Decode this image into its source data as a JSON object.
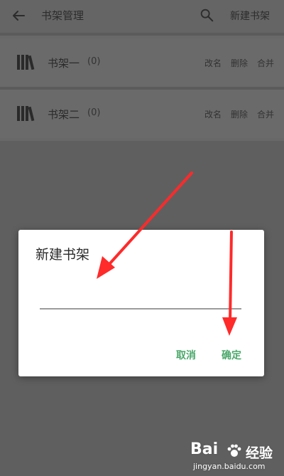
{
  "appbar": {
    "title": "书架管理",
    "new_shelf_label": "新建书架",
    "icons": [
      "back-arrow-icon",
      "search-icon"
    ]
  },
  "shelves": [
    {
      "name": "书架一",
      "count": "(0)",
      "rename": "改名",
      "delete": "删除",
      "merge": "合并"
    },
    {
      "name": "书架二",
      "count": "(0)",
      "rename": "改名",
      "delete": "删除",
      "merge": "合并"
    }
  ],
  "dialog": {
    "title": "新建书架",
    "input_value": "",
    "cancel_label": "取消",
    "ok_label": "确定"
  },
  "watermark": {
    "logo": "Bai",
    "brand": "经验",
    "url": "jingyan.baidu.com"
  },
  "colors": {
    "accent": "#4aa86a",
    "annotation_arrow": "#ff2a2a",
    "overlay_bg": "#5f5f5f"
  }
}
